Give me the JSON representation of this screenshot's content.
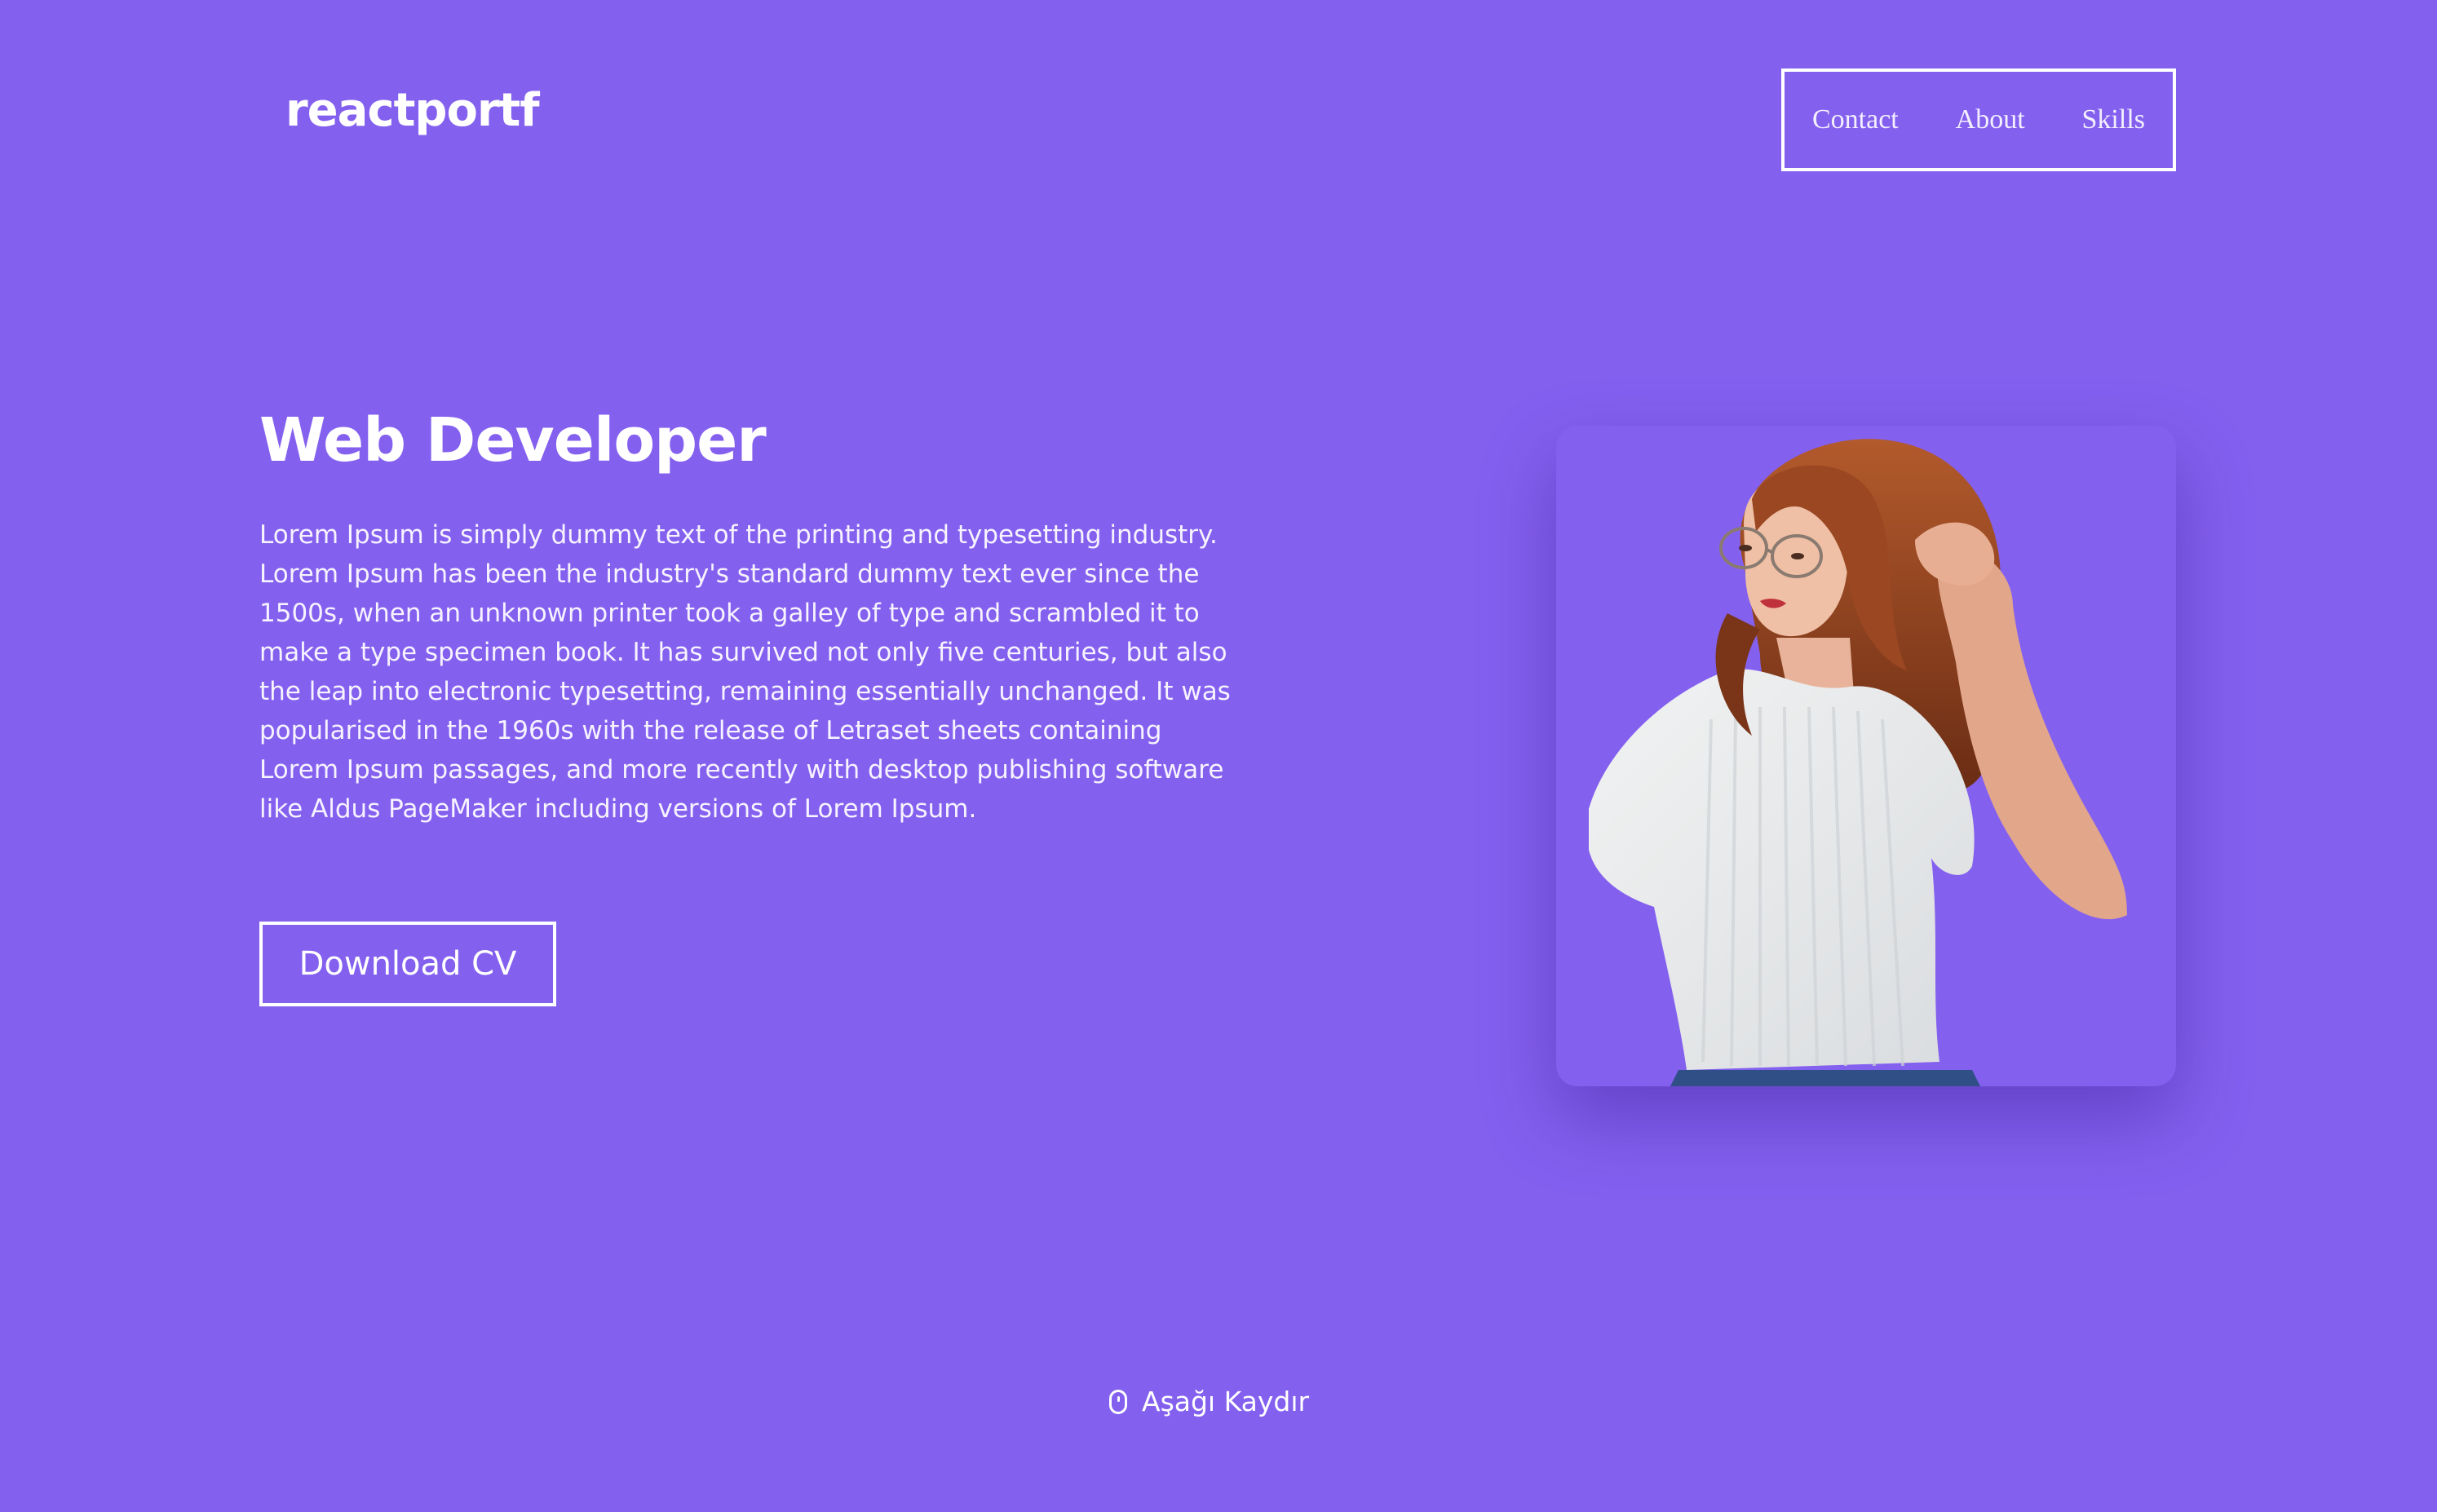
{
  "header": {
    "logo": "reactportf",
    "nav": [
      {
        "label": "Contact"
      },
      {
        "label": "About"
      },
      {
        "label": "Skills"
      }
    ]
  },
  "hero": {
    "title": "Web Developer",
    "description": "Lorem Ipsum is simply dummy text of the printing and typesetting industry. Lorem Ipsum has been the industry's standard dummy text ever since the 1500s, when an unknown printer took a galley of type and scrambled it to make a type specimen book. It has survived not only five centuries, but also the leap into electronic typesetting, remaining essentially unchanged. It was popularised in the 1960s with the release of Letraset sheets containing Lorem Ipsum passages, and more recently with desktop publishing software like Aldus PageMaker including versions of Lorem Ipsum.",
    "cta_label": "Download CV"
  },
  "scroll": {
    "label": "Aşağı Kaydır",
    "icon": "mouse-icon"
  },
  "colors": {
    "background": "#8460ef",
    "text": "#ffffff"
  }
}
